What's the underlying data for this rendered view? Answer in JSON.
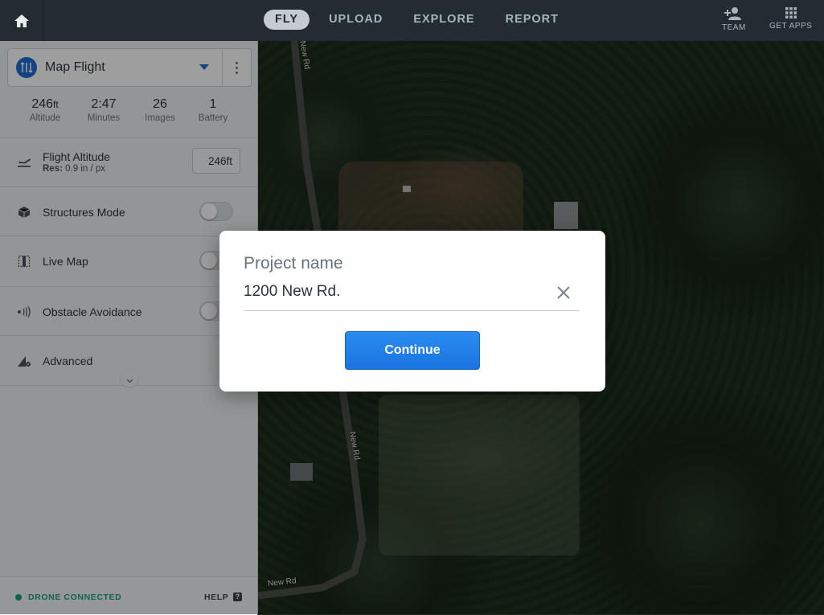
{
  "topbar": {
    "tabs": [
      {
        "label": "FLY",
        "active": true
      },
      {
        "label": "UPLOAD",
        "active": false
      },
      {
        "label": "EXPLORE",
        "active": false
      },
      {
        "label": "REPORT",
        "active": false
      }
    ],
    "team_label": "TEAM",
    "apps_label": "GET APPS",
    "icons": {
      "home": "home-icon",
      "team": "add-team-icon",
      "apps": "grid-apps-icon"
    }
  },
  "panel": {
    "plan_name": "Map Flight",
    "stats": [
      {
        "value": "246",
        "unit": "ft",
        "label": "Altitude"
      },
      {
        "value": "2:47",
        "unit": "",
        "label": "Minutes"
      },
      {
        "value": "26",
        "unit": "",
        "label": "Images"
      },
      {
        "value": "1",
        "unit": "",
        "label": "Battery"
      }
    ],
    "flight_altitude": {
      "title": "Flight Altitude",
      "res_label": "Res:",
      "res_value": "0.9 in / px",
      "value": "246ft"
    },
    "structures_mode": {
      "title": "Structures Mode",
      "on": false
    },
    "live_map": {
      "title": "Live Map",
      "on": false
    },
    "obstacle_avoidance": {
      "title": "Obstacle Avoidance",
      "on": false
    },
    "advanced": {
      "title": "Advanced"
    },
    "footer": {
      "status": "DRONE CONNECTED",
      "help": "HELP",
      "help_glyph": "?"
    }
  },
  "map": {
    "road_labels": [
      "New Rd",
      "New Rd",
      "New Rd"
    ]
  },
  "dialog": {
    "label": "Project name",
    "value": "1200 New Rd.",
    "button": "Continue"
  },
  "colors": {
    "accent": "#1f6fd1",
    "button": "#1a73e0",
    "status": "#1f9f77",
    "topbar": "#232b33"
  }
}
